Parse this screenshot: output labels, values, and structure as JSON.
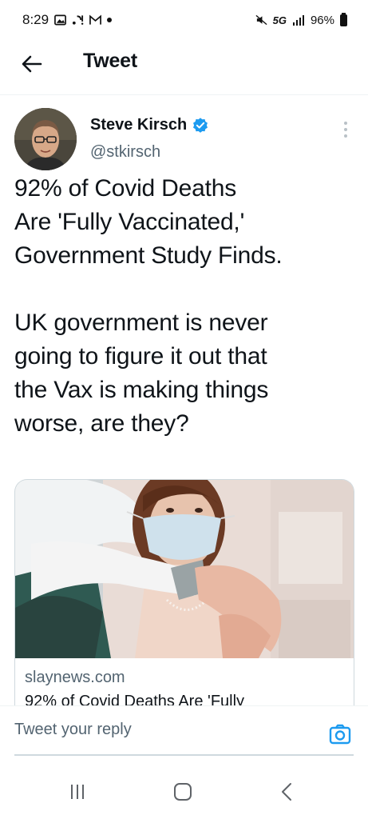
{
  "status_bar": {
    "time": "8:29",
    "network": "5G",
    "battery": "96%",
    "icons": [
      "gallery-icon",
      "notification-icon",
      "gmail-icon",
      "dot-icon",
      "mute-icon",
      "signal-icon",
      "battery-icon"
    ]
  },
  "header": {
    "title": "Tweet",
    "back_icon": "arrow-left-icon"
  },
  "tweet": {
    "author_name": "Steve Kirsch",
    "author_handle": "@stkirsch",
    "verified": true,
    "text": "92% of Covid Deaths\nAre 'Fully Vaccinated,'\nGovernment Study Finds.\n\nUK government is never\ngoing to figure it out that\nthe Vax is making things\nworse, are they?",
    "card": {
      "domain": "slaynews.com",
      "title": "92% of Covid Deaths Are 'Fully"
    }
  },
  "reply": {
    "placeholder": "Tweet your reply",
    "camera_icon": "camera-icon"
  },
  "nav": {
    "icons": [
      "recent-apps-icon",
      "home-icon",
      "back-icon"
    ]
  },
  "colors": {
    "accent": "#1d9bf0",
    "text_primary": "#0f1419",
    "text_secondary": "#536471",
    "border": "#cfd9de"
  }
}
